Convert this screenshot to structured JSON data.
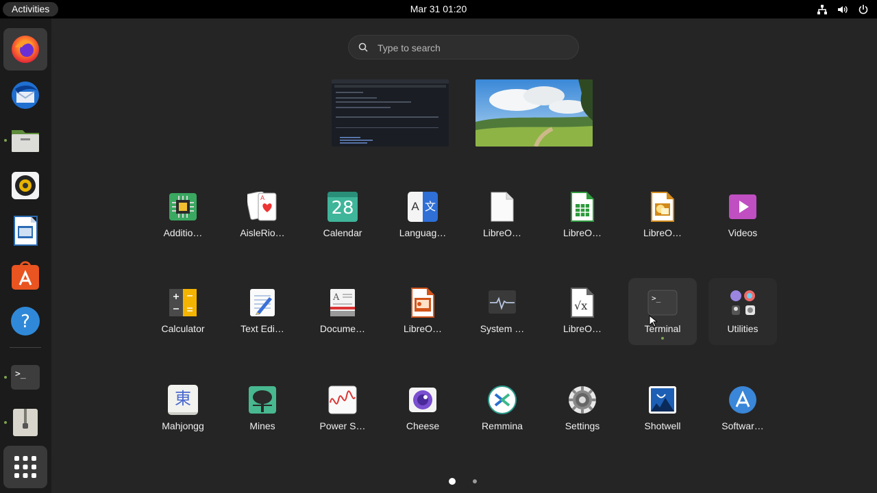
{
  "topbar": {
    "activities": "Activities",
    "clock": "Mar 31  01:20"
  },
  "search": {
    "placeholder": "Type to search"
  },
  "dock": [
    {
      "name": "Firefox",
      "icon": "firefox-icon",
      "running": true
    },
    {
      "name": "Thunderbird",
      "icon": "thunderbird-icon",
      "running": false
    },
    {
      "name": "Files",
      "icon": "files-icon",
      "running": true
    },
    {
      "name": "Rhythmbox",
      "icon": "rhythmbox-icon",
      "running": false
    },
    {
      "name": "LibreOffice Writer",
      "icon": "writer-icon",
      "running": false
    },
    {
      "name": "App Center",
      "icon": "app-center-icon",
      "running": false
    },
    {
      "name": "Help",
      "icon": "help-icon",
      "running": false
    },
    {
      "name": "Terminal",
      "icon": "terminal-icon",
      "running": true
    },
    {
      "name": "Archive",
      "icon": "archive-icon",
      "running": true
    },
    {
      "name": "Show Apps",
      "icon": "show-apps-icon",
      "running": false
    }
  ],
  "apps": [
    {
      "label": "Additio…",
      "icon": "chip-icon"
    },
    {
      "label": "AisleRio…",
      "icon": "cards-icon"
    },
    {
      "label": "Calendar",
      "icon": "calendar-icon",
      "badge": "28"
    },
    {
      "label": "Languag…",
      "icon": "language-icon",
      "badge_a": "A",
      "badge_b": "文"
    },
    {
      "label": "LibreO…",
      "icon": "libreoffice-icon"
    },
    {
      "label": "LibreO…",
      "icon": "calc-icon"
    },
    {
      "label": "LibreO…",
      "icon": "draw-icon"
    },
    {
      "label": "Videos",
      "icon": "videos-icon"
    },
    {
      "label": "Calculator",
      "icon": "calculator-icon"
    },
    {
      "label": "Text Edi…",
      "icon": "text-editor-icon"
    },
    {
      "label": "Docume…",
      "icon": "document-viewer-icon"
    },
    {
      "label": "LibreO…",
      "icon": "impress-icon"
    },
    {
      "label": "System …",
      "icon": "system-monitor-icon"
    },
    {
      "label": "LibreO…",
      "icon": "math-icon"
    },
    {
      "label": "Terminal",
      "icon": "terminal-icon",
      "highlight": true
    },
    {
      "label": "Utilities",
      "icon": "utilities-folder-icon",
      "highlight": true
    },
    {
      "label": "Mahjongg",
      "icon": "mahjongg-icon",
      "badge": "東"
    },
    {
      "label": "Mines",
      "icon": "mines-icon"
    },
    {
      "label": "Power S…",
      "icon": "power-stats-icon"
    },
    {
      "label": "Cheese",
      "icon": "cheese-icon"
    },
    {
      "label": "Remmina",
      "icon": "remmina-icon"
    },
    {
      "label": "Settings",
      "icon": "settings-icon"
    },
    {
      "label": "Shotwell",
      "icon": "shotwell-icon"
    },
    {
      "label": "Softwar…",
      "icon": "software-icon"
    }
  ],
  "pager": {
    "pages": 2,
    "current": 1
  },
  "colors": {
    "accent_dot": "#7da44f",
    "panel": "#000000",
    "overview_bg": "#252525",
    "dock_bg": "#1b1b1b"
  }
}
